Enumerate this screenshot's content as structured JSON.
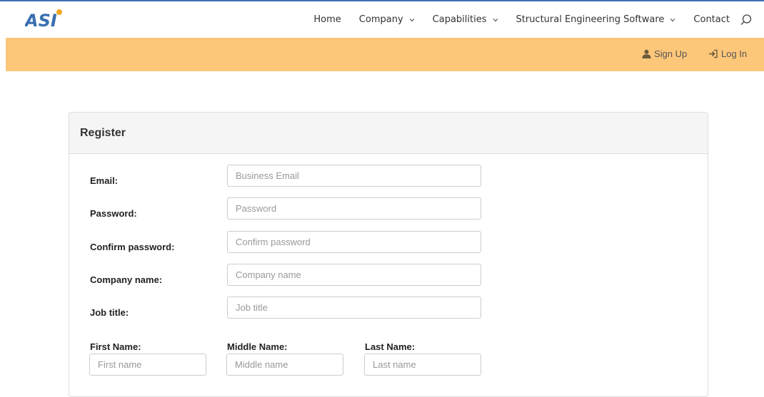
{
  "brand": {
    "logo_text": "ASI",
    "accent": "#3a6fb0",
    "logo_dot": "#f5a623"
  },
  "nav": {
    "items": [
      {
        "label": "Home",
        "has_dropdown": false
      },
      {
        "label": "Company",
        "has_dropdown": true
      },
      {
        "label": "Capabilities",
        "has_dropdown": true
      },
      {
        "label": "Structural Engineering Software",
        "has_dropdown": true
      },
      {
        "label": "Contact",
        "has_dropdown": false
      }
    ],
    "search_icon": "search-icon"
  },
  "subbar": {
    "color": "#fdc77a",
    "signup_label": "Sign Up",
    "login_label": "Log In"
  },
  "register": {
    "title": "Register",
    "fields": [
      {
        "label": "Email:",
        "placeholder": "Business Email"
      },
      {
        "label": "Password:",
        "placeholder": "Password"
      },
      {
        "label": "Confirm password:",
        "placeholder": "Confirm password"
      },
      {
        "label": "Company name:",
        "placeholder": "Company name"
      },
      {
        "label": "Job title:",
        "placeholder": "Job title"
      }
    ],
    "names": [
      {
        "label": "First Name:",
        "placeholder": "First name"
      },
      {
        "label": "Middle Name:",
        "placeholder": "Middle name"
      },
      {
        "label": "Last Name:",
        "placeholder": "Last name"
      }
    ]
  }
}
